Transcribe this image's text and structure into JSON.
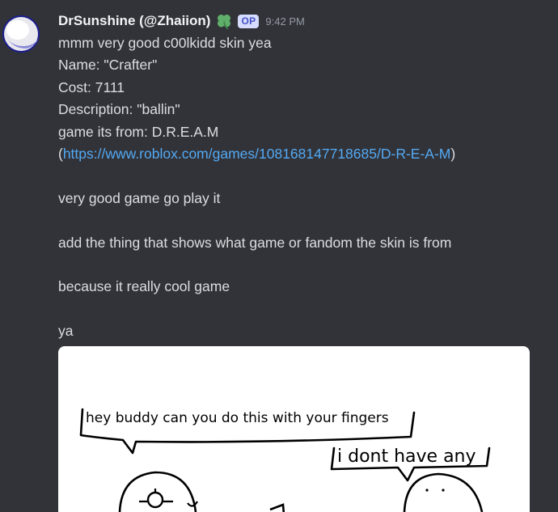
{
  "message": {
    "author": {
      "display_name": "DrSunshine (@Zhaiion)",
      "badge": "OP",
      "badge_icon": "clover-icon"
    },
    "timestamp": "9:42 PM",
    "lines": {
      "l1": "mmm very good c00lkidd skin yea",
      "l2": "Name: \"Crafter\"",
      "l3": "Cost: 7111",
      "l4": "Description: \"ballin\"",
      "l5": "game its from: D.R.E.A.M",
      "l6_open": "(",
      "l6_link": "https://www.roblox.com/games/108168147718685/D-R-E-A-M",
      "l6_close": ")",
      "l7": "very good game go play it",
      "l8": "add the thing that shows what game or fandom the skin is from",
      "l9": "because it really cool game",
      "l10": "ya"
    },
    "attachment": {
      "bubble_left": "hey buddy can you do this with your fingers",
      "bubble_right": "i dont have any"
    }
  },
  "colors": {
    "background": "#323339",
    "text": "#dbdee1",
    "username": "#f2f3f5",
    "link": "#53a9f3",
    "timestamp": "#949ba4",
    "badge_bg": "#d6dcff",
    "badge_text": "#4752c4"
  }
}
